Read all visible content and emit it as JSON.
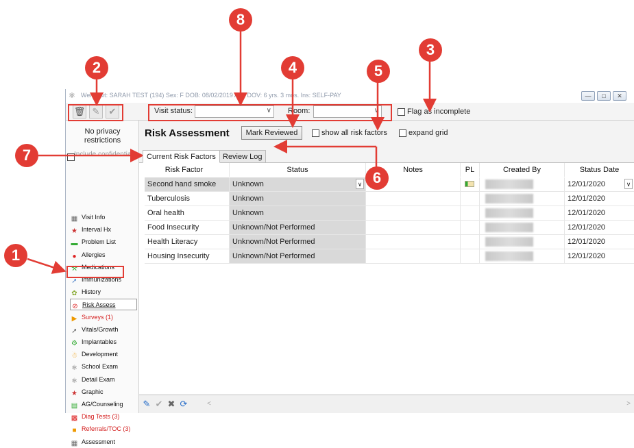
{
  "window": {
    "title": "Well Visit: SARAH TEST (194)  Sex: F  DOB: 08/02/2019  Age DOV: 6 yrs. 3 mos.  Ins: SELF-PAY"
  },
  "toolbar": {
    "visit_status_label": "Visit status:",
    "visit_status_value": "",
    "room_label": "Room:",
    "room_value": "",
    "flag_incomplete_label": "Flag as incomplete"
  },
  "sidebar": {
    "privacy": "No privacy restrictions",
    "include_confidential": "Include confidential",
    "items": [
      {
        "label": "Visit Info",
        "icon": "visit-info-icon",
        "red": false
      },
      {
        "label": "Interval Hx",
        "icon": "interval-hx-icon",
        "red": false
      },
      {
        "label": "Problem List",
        "icon": "problem-list-icon",
        "red": false
      },
      {
        "label": "Allergies",
        "icon": "allergies-icon",
        "red": false
      },
      {
        "label": "Medications",
        "icon": "medications-icon",
        "red": false
      },
      {
        "label": "Immunizations",
        "icon": "immunizations-icon",
        "red": false
      },
      {
        "label": "History",
        "icon": "history-icon",
        "red": false
      },
      {
        "label": "Risk Assess",
        "icon": "risk-assess-icon",
        "red": false,
        "selected": true
      },
      {
        "label": "Surveys (1)",
        "icon": "surveys-icon",
        "red": true
      },
      {
        "label": "Vitals/Growth",
        "icon": "vitals-icon",
        "red": false
      },
      {
        "label": "Implantables",
        "icon": "implantables-icon",
        "red": false
      },
      {
        "label": "Development",
        "icon": "development-icon",
        "red": false
      },
      {
        "label": "School Exam",
        "icon": "school-exam-icon",
        "red": false
      },
      {
        "label": "Detail Exam",
        "icon": "detail-exam-icon",
        "red": false
      },
      {
        "label": "Graphic",
        "icon": "graphic-icon",
        "red": false
      },
      {
        "label": "AG/Counseling",
        "icon": "counseling-icon",
        "red": false
      },
      {
        "label": "Diag Tests (3)",
        "icon": "diag-tests-icon",
        "red": true
      },
      {
        "label": "Referrals/TOC (3)",
        "icon": "referrals-icon",
        "red": true
      },
      {
        "label": "Assessment",
        "icon": "assessment-icon",
        "red": false
      }
    ]
  },
  "main": {
    "heading": "Risk Assessment",
    "mark_reviewed": "Mark Reviewed",
    "show_all_label": "show all risk factors",
    "expand_grid_label": "expand grid",
    "tabs": [
      "Current Risk Factors",
      "Review Log"
    ],
    "columns": [
      "Risk Factor",
      "Status",
      "Notes",
      "PL",
      "Created By",
      "Status Date"
    ],
    "rows": [
      {
        "factor": "Second hand smoke",
        "status": "Unknown",
        "date": "12/01/2020"
      },
      {
        "factor": "Tuberculosis",
        "status": "Unknown",
        "date": "12/01/2020"
      },
      {
        "factor": "Oral health",
        "status": "Unknown",
        "date": "12/01/2020"
      },
      {
        "factor": "Food Insecurity",
        "status": "Unknown/Not Performed",
        "date": "12/01/2020"
      },
      {
        "factor": "Health Literacy",
        "status": "Unknown/Not Performed",
        "date": "12/01/2020"
      },
      {
        "factor": "Housing Insecurity",
        "status": "Unknown/Not Performed",
        "date": "12/01/2020"
      }
    ]
  },
  "callouts": [
    "1",
    "2",
    "3",
    "4",
    "5",
    "6",
    "7",
    "8"
  ],
  "colors": {
    "annotation_red": "#e23c34",
    "alert_red": "#d42020"
  }
}
